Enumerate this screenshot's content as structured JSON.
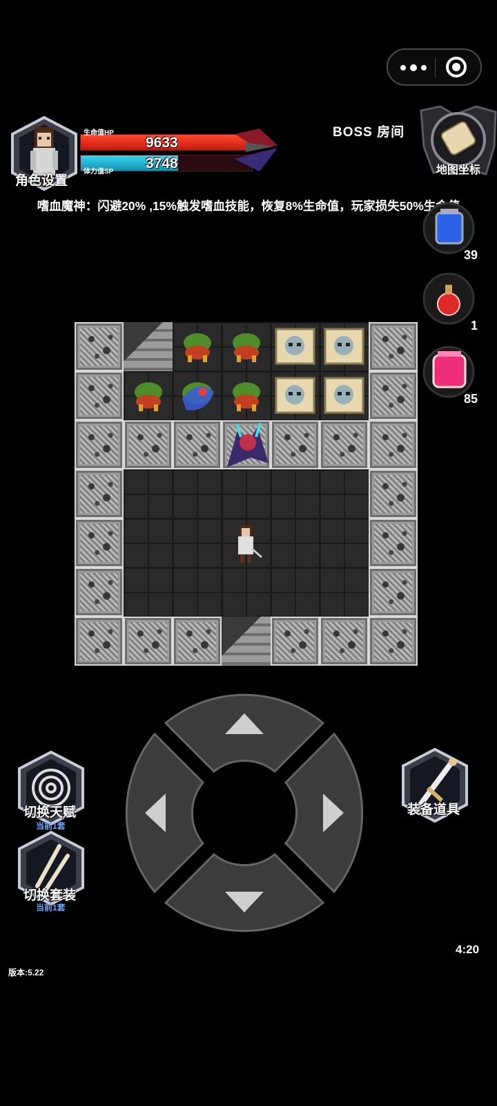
{
  "hud": {
    "avatar_label": "角色设置",
    "hp_label": "生命值HP",
    "hp_value": "9633",
    "sp_label": "体力值SP",
    "sp_value": "3748",
    "room_title": "BOSS  房间",
    "map_label": "地图坐标",
    "status_text": "嗜血魔神：闪避20% ,15%触发嗜血技能，恢复8%生命值，玩家损失50%生命值",
    "colors": {
      "hp": "#e02a1e",
      "sp": "#19b4d4"
    }
  },
  "potions": [
    {
      "name": "blue-potion",
      "count": "39",
      "color": "#2a62e8"
    },
    {
      "name": "red-potion",
      "count": "1",
      "color": "#e02a2a"
    },
    {
      "name": "pink-potion",
      "count": "85",
      "color": "#ee2f78"
    }
  ],
  "board": {
    "rows": [
      [
        "wall",
        "stairs",
        "slime",
        "slime",
        "chest",
        "chest",
        "wall"
      ],
      [
        "wall",
        "slime",
        "slime-boss",
        "slime",
        "chest",
        "chest",
        "wall"
      ],
      [
        "wall",
        "wall",
        "wall",
        "boss",
        "wall",
        "wall",
        "wall"
      ],
      [
        "wall",
        "floor",
        "floor",
        "floor",
        "floor",
        "floor",
        "wall"
      ],
      [
        "wall",
        "floor",
        "floor",
        "hero",
        "floor",
        "floor",
        "wall"
      ],
      [
        "wall",
        "floor",
        "floor",
        "floor",
        "floor",
        "floor",
        "wall"
      ],
      [
        "wall",
        "wall",
        "wall",
        "stairs",
        "wall",
        "wall",
        "wall"
      ]
    ]
  },
  "controls": {
    "talent_label": "切换天赋",
    "talent_sub": "当前1套",
    "outfit_label": "切换套装",
    "outfit_sub": "当前1套",
    "equip_label": "装备道具"
  },
  "footer": {
    "version": "版本:5.22",
    "time": "4:20"
  }
}
